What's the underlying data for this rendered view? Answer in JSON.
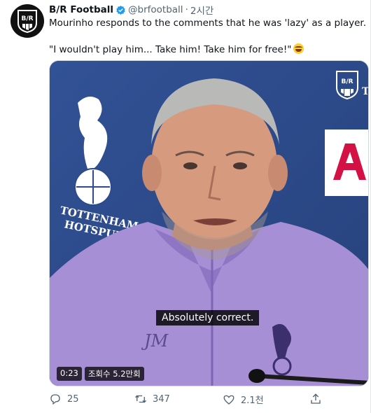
{
  "tweet": {
    "author_name": "B/R Football",
    "author_handle": "@brfootball",
    "separator": "·",
    "timestamp": "2시간",
    "text_line1": "Mourinho responds to the comments that he was 'lazy' as a player.",
    "text_line2": "\"I wouldn't play him... Take him! Take him for free!\"",
    "emoji_icon": "rolling-on-floor-laughing-emoji"
  },
  "media": {
    "subtitle": "Absolutely correct.",
    "duration": "0:23",
    "views": "조회수 5.2만회",
    "background_wall_text": "TOTTENHAM HOTSPUR",
    "crest_letters": "JM"
  },
  "actions": {
    "reply_count": "25",
    "retweet_count": "347",
    "like_count": "2.1천"
  },
  "colors": {
    "brand_blue": "#1d9bf0",
    "backdrop_navy": "#2d4b8c",
    "shirt_lilac": "#a78fd6"
  }
}
